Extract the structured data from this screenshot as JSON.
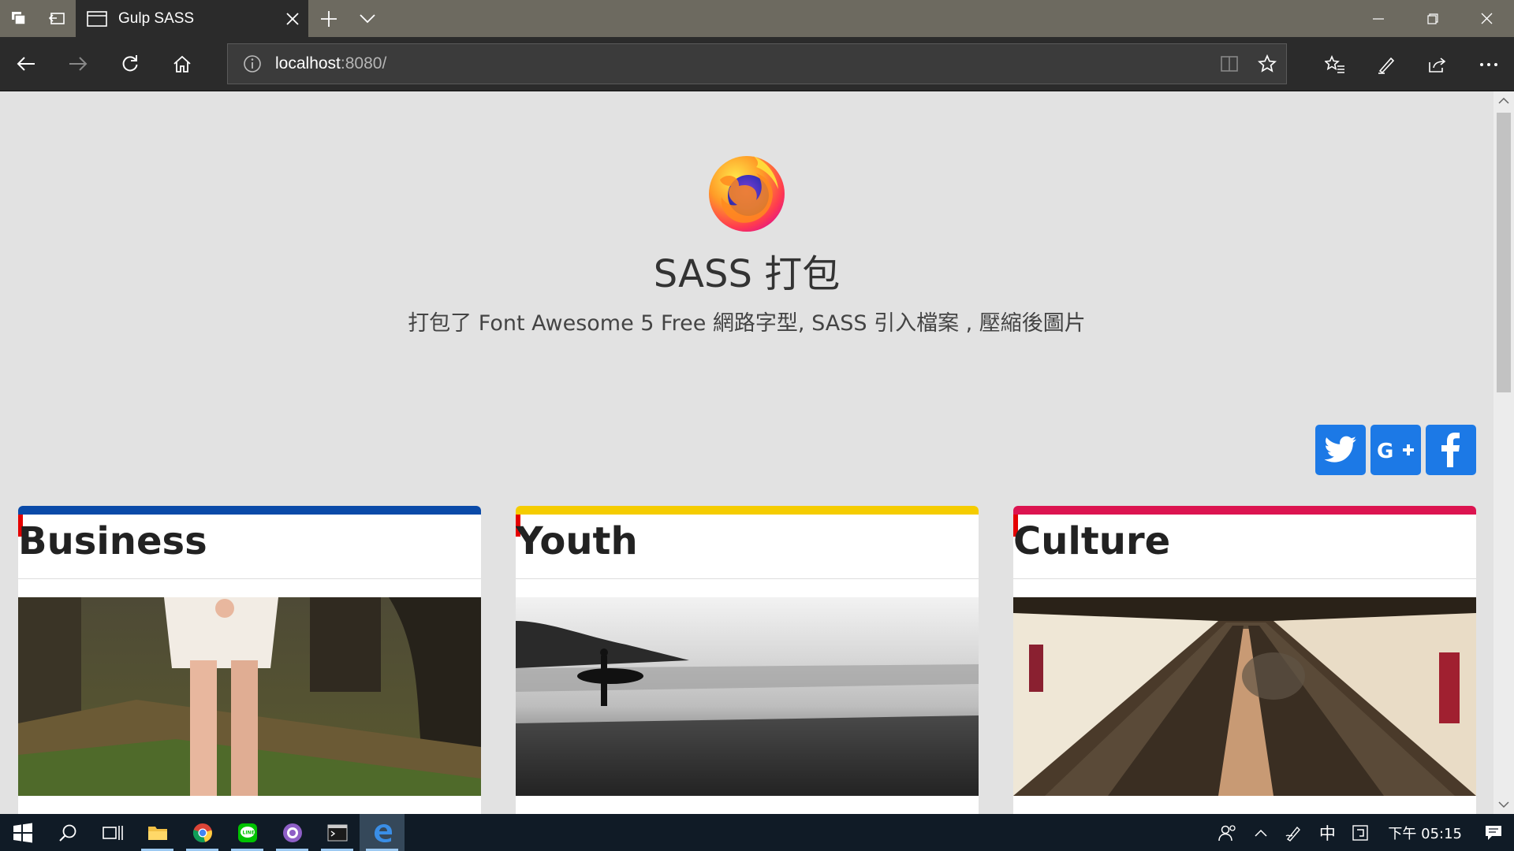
{
  "browser": {
    "tab": {
      "title": "Gulp SASS"
    },
    "address": {
      "host": "localhost",
      "rest": ":8080/"
    }
  },
  "page": {
    "title": "SASS 打包",
    "subtitle": "打包了 Font Awesome 5 Free 網路字型, SASS 引入檔案 , 壓縮後圖片",
    "social": [
      "twitter-icon",
      "google-plus-icon",
      "facebook-icon"
    ],
    "cards": [
      {
        "title": "Business",
        "accent": "#0a4aa8"
      },
      {
        "title": "Youth",
        "accent": "#f5cc00"
      },
      {
        "title": "Culture",
        "accent": "#dc1450"
      }
    ],
    "accent_social": "#1c79e6"
  },
  "taskbar": {
    "apps": [
      "windows-start-icon",
      "search-icon",
      "task-view-icon",
      "file-explorer-icon",
      "chrome-icon",
      "line-icon",
      "app-icon",
      "terminal-icon",
      "edge-icon"
    ],
    "tray": {
      "ime": "中",
      "clock": "下午 05:15"
    }
  }
}
